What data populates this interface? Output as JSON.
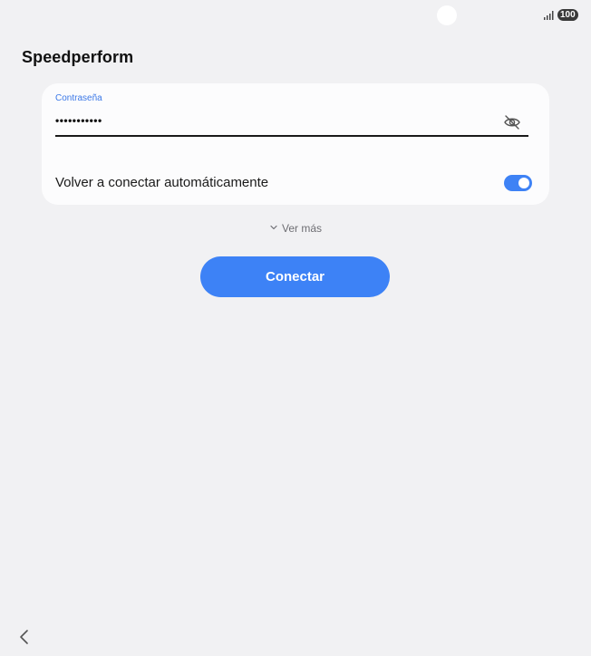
{
  "status_bar": {
    "battery_level": "100",
    "signal_icon": "signal-icon",
    "camera_icon": "camera-cutout-icon"
  },
  "header": {
    "title": "Speedperform"
  },
  "card": {
    "password_label": "Contraseña",
    "password_value": "•••••••••••",
    "visibility_icon": "eye-off-icon",
    "reconnect_label": "Volver a conectar automáticamente",
    "reconnect_enabled": true
  },
  "see_more": {
    "label": "Ver más",
    "icon": "chevron-down-icon"
  },
  "actions": {
    "connect_label": "Conectar"
  },
  "navigation": {
    "back_icon": "back-icon"
  },
  "colors": {
    "accent": "#3d82f6",
    "label_blue": "#3b78e7",
    "background": "#f1f1f3",
    "card": "#fcfcfd"
  }
}
